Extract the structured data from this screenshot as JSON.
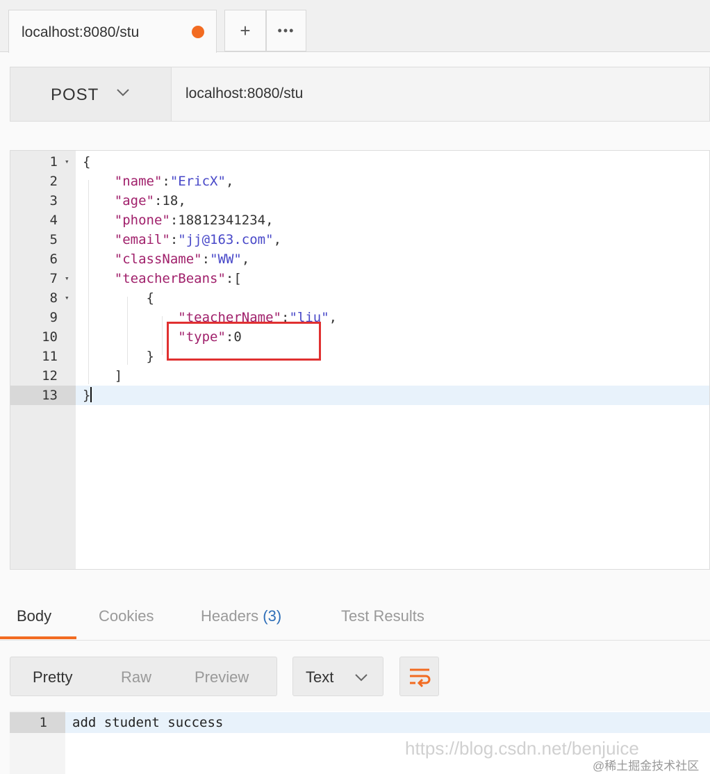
{
  "tab": {
    "label": "localhost:8080/stu",
    "unsaved_dot_color": "#f26b21",
    "add_label": "+",
    "more_label": "•••"
  },
  "request": {
    "method": "POST",
    "url": "localhost:8080/stu"
  },
  "editor": {
    "lines": [
      {
        "num": "1",
        "fold": "▾"
      },
      {
        "num": "2",
        "fold": ""
      },
      {
        "num": "3",
        "fold": ""
      },
      {
        "num": "4",
        "fold": ""
      },
      {
        "num": "5",
        "fold": ""
      },
      {
        "num": "6",
        "fold": ""
      },
      {
        "num": "7",
        "fold": "▾"
      },
      {
        "num": "8",
        "fold": "▾"
      },
      {
        "num": "9",
        "fold": ""
      },
      {
        "num": "10",
        "fold": ""
      },
      {
        "num": "11",
        "fold": ""
      },
      {
        "num": "12",
        "fold": ""
      },
      {
        "num": "13",
        "fold": ""
      }
    ],
    "tokens": {
      "l1_open": "{",
      "l2_key": "\"name\"",
      "l2_val": "\"EricX\"",
      "l3_key": "\"age\"",
      "l3_val": "18",
      "l4_key": "\"phone\"",
      "l4_val": "18812341234",
      "l5_key": "\"email\"",
      "l5_val": "\"jj@163.com\"",
      "l6_key": "\"className\"",
      "l6_val": "\"WW\"",
      "l7_key": "\"teacherBeans\"",
      "l7_open": "[",
      "l8_open": "{",
      "l9_key": "\"teacherName\"",
      "l9_val": "\"liu\"",
      "l10_key": "\"type\"",
      "l10_val": "0",
      "l11_close": "}",
      "l12_close": "]",
      "l13_close": "}",
      "colon": ":",
      "comma": ","
    },
    "active_line": "13",
    "highlight_color": "#e03030"
  },
  "response_tabs": {
    "body": "Body",
    "cookies": "Cookies",
    "headers": "Headers",
    "headers_count": "(3)",
    "test_results": "Test Results",
    "active": "Body"
  },
  "view": {
    "pretty": "Pretty",
    "raw": "Raw",
    "preview": "Preview",
    "format": "Text",
    "active": "Pretty"
  },
  "response": {
    "line_num": "1",
    "text": "add student success"
  },
  "watermark": {
    "url": "https://blog.csdn.net/benjuice",
    "credit": "@稀土掘金技术社区"
  },
  "accent_color": "#f26b21"
}
